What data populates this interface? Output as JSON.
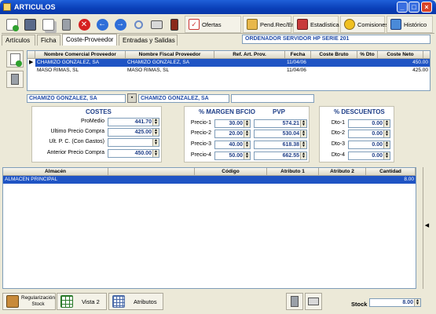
{
  "window": {
    "title": "ARTICULOS"
  },
  "toolbar": {
    "icons": [
      "add-icon",
      "save-icon",
      "copy-icon",
      "delete-icon",
      "cancel-icon",
      "back-icon",
      "forward-icon",
      "find-icon",
      "print-icon",
      "exit-icon"
    ],
    "ofertas": "Ofertas",
    "pend_rec_ent": "Pend.Rec/Ent",
    "estadistica": "Estadística",
    "comisiones": "Comisiones",
    "historico": "Histórico"
  },
  "tabs": [
    "Artículos",
    "Ficha",
    "Coste-Proveedor",
    "Entradas y Salidas"
  ],
  "active_tab": "Coste-Proveedor",
  "article_title": "ORDENADOR SERVIDOR HP SERIE 201",
  "providers": {
    "columns": [
      "Nombre Comercial Proveedor",
      "Nombre Fiscal Proveedor",
      "Ref. Art. Prov.",
      "Fecha",
      "Coste Bruto",
      "% Dto",
      "Coste Neto"
    ],
    "rows": [
      {
        "comercial": "CHAMIZO GONZALEZ, SA",
        "fiscal": "CHAMIZO GONZALEZ, SA",
        "ref": "",
        "fecha": "11/04/06",
        "bruto": "",
        "dto": "",
        "neto": "450.00"
      },
      {
        "comercial": "MASO RIMAS, SL",
        "fiscal": "MASO RIMAS, SL",
        "ref": "",
        "fecha": "11/04/06",
        "bruto": "",
        "dto": "",
        "neto": "425.00"
      }
    ]
  },
  "selected_provider": {
    "comercial": "CHAMIZO GONZALEZ, SA",
    "fiscal": "CHAMIZO GONZALEZ, SA"
  },
  "costes": {
    "title": "COSTES",
    "rows": [
      {
        "label": "ProMedio",
        "value": "441.70"
      },
      {
        "label": "Ultimo Precio Compra",
        "value": "425.00"
      },
      {
        "label": "Ult. P. C. (Con Gastos)",
        "value": ""
      },
      {
        "label": "Anterior Precio Compra",
        "value": "450.00"
      }
    ]
  },
  "margen": {
    "title_margin": "% MARGEN BFCIO",
    "title_pvp": "PVP",
    "rows": [
      {
        "label": "Precio-1",
        "margin": "30.00",
        "pvp": "574.21"
      },
      {
        "label": "Precio-2",
        "margin": "20.00",
        "pvp": "530.04"
      },
      {
        "label": "Precio-3",
        "margin": "40.00",
        "pvp": "618.38"
      },
      {
        "label": "Precio-4",
        "margin": "50.00",
        "pvp": "662.55"
      }
    ]
  },
  "descuentos": {
    "title": "% DESCUENTOS",
    "rows": [
      {
        "label": "Dto-1",
        "value": "0.00"
      },
      {
        "label": "Dto-2",
        "value": "0.00"
      },
      {
        "label": "Dto-3",
        "value": "0.00"
      },
      {
        "label": "Dto-4",
        "value": "0.00"
      }
    ]
  },
  "stock_grid": {
    "columns": [
      "Almacén",
      "",
      "Código",
      "Atributo 1",
      "Atributo 2",
      "Cantidad"
    ],
    "rows": [
      {
        "almacen": "ALMACEN PRINCIPAL",
        "codigo": "",
        "atr1": "",
        "atr2": "",
        "cantidad": "8.00"
      }
    ]
  },
  "bottom": {
    "regularizacion": "Regularización Stock",
    "vista2": "Vista 2",
    "atributos": "Atributos",
    "stock_label": "Stock",
    "stock_value": "8.00"
  },
  "colors": {
    "accent": "#1f54c4",
    "title_blue": "#1f3f88",
    "bg": "#ece9d8"
  }
}
